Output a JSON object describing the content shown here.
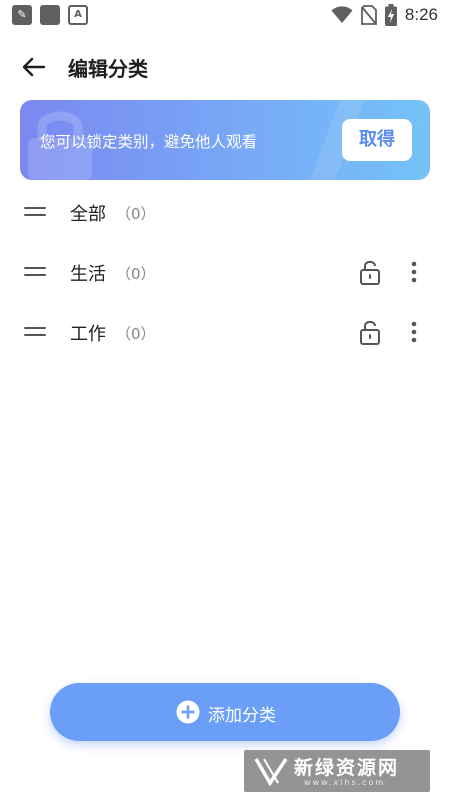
{
  "status_bar": {
    "time": "8:26",
    "left_icons": [
      "edit-app-icon",
      "square-app-icon",
      "a-app-icon"
    ],
    "right_icons": [
      "wifi-icon",
      "no-sim-icon",
      "battery-charging-icon"
    ]
  },
  "header": {
    "back_icon": "arrow-left-icon",
    "title": "编辑分类"
  },
  "banner": {
    "text": "您可以锁定类别，避免他人观看",
    "button_label": "取得",
    "gradient_colors": [
      "#7a88f0",
      "#74c3f8"
    ]
  },
  "categories": [
    {
      "name": "全部",
      "count": "（0）",
      "lockable": false
    },
    {
      "name": "生活",
      "count": "（0）",
      "lockable": true
    },
    {
      "name": "工作",
      "count": "（0）",
      "lockable": true
    }
  ],
  "add_button": {
    "label": "添加分类",
    "icon": "plus-circle-icon",
    "color": "#6a9ef7"
  },
  "watermark": {
    "title": "新绿资源网",
    "url": "www.xlhs.com"
  }
}
